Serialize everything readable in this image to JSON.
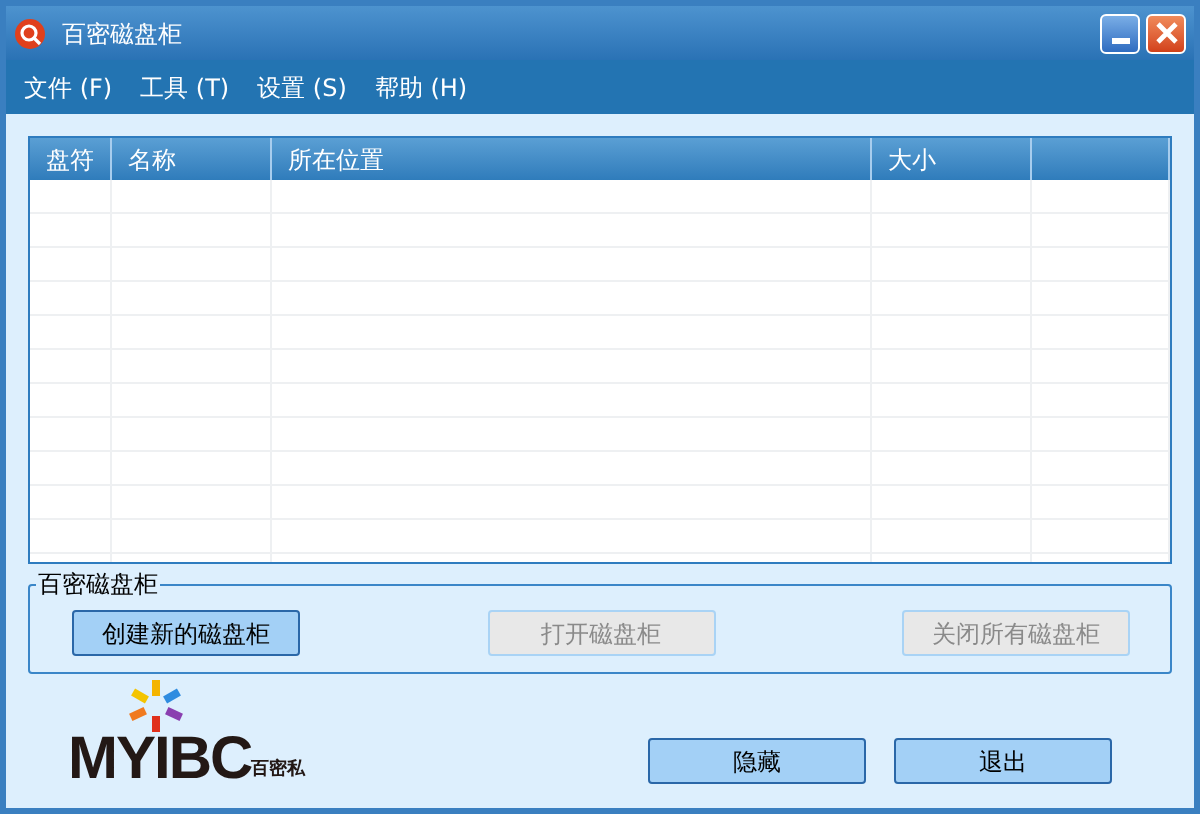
{
  "window": {
    "title": "百密磁盘柜"
  },
  "menu": [
    {
      "label": "文件 (F)"
    },
    {
      "label": "工具 (T)"
    },
    {
      "label": "设置 (S)"
    },
    {
      "label": "帮助 (H)"
    }
  ],
  "table": {
    "columns": [
      "盘符",
      "名称",
      "所在位置",
      "大小",
      ""
    ]
  },
  "group": {
    "title": "百密磁盘柜",
    "buttons": [
      {
        "label": "创建新的磁盘柜",
        "disabled": false
      },
      {
        "label": "打开磁盘柜",
        "disabled": true
      },
      {
        "label": "关闭所有磁盘柜",
        "disabled": true
      }
    ]
  },
  "logo": {
    "text": "MYIBC",
    "subtext": "百密私"
  },
  "buttons": [
    {
      "label": "隐藏"
    },
    {
      "label": "退出"
    }
  ]
}
